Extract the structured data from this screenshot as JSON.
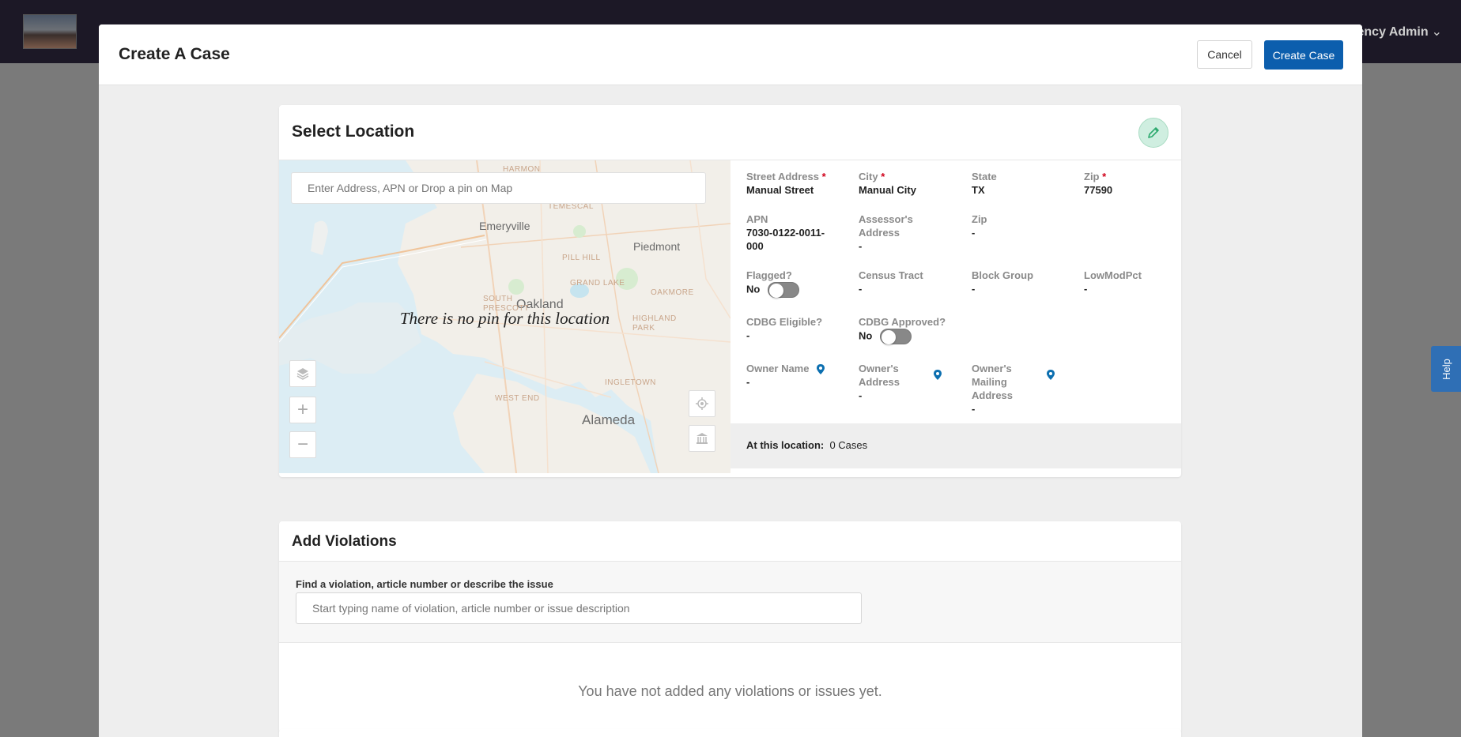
{
  "app": {
    "user_label": "ency Admin"
  },
  "help": {
    "label": "Help"
  },
  "modal": {
    "title": "Create A Case",
    "cancel_label": "Cancel",
    "create_label": "Create Case"
  },
  "location": {
    "title": "Select Location",
    "search_placeholder": "Enter Address, APN or Drop a pin on Map",
    "no_pin_message": "There is no pin for this location",
    "map_labels": {
      "emeryville": "Emeryville",
      "piedmont": "Piedmont",
      "oakland": "Oakland",
      "alameda": "Alameda",
      "harmon": "HARMON",
      "temescal": "TEMESCAL",
      "pill_hill": "PILL HILL",
      "grand_lake": "GRAND LAKE",
      "oakmore": "OAKMORE",
      "south_prescott": "SOUTH PRESCOTT",
      "highland_park": "HIGHLAND PARK",
      "west_end": "WEST END",
      "ingletown": "INGLETOWN"
    },
    "fields": {
      "street_label": "Street Address",
      "street_value": "Manual Street",
      "city_label": "City",
      "city_value": "Manual City",
      "state_label": "State",
      "state_value": "TX",
      "zip_label": "Zip",
      "zip_value": "77590",
      "apn_label": "APN",
      "apn_value_1": "7030-0122-0011-",
      "apn_value_2": "000",
      "assessor_label_1": "Assessor's",
      "assessor_label_2": "Address",
      "assessor_value": "-",
      "zip2_label": "Zip",
      "zip2_value": "-",
      "flagged_label": "Flagged?",
      "flagged_value": "No",
      "census_label": "Census Tract",
      "census_value": "-",
      "block_label": "Block Group",
      "block_value": "-",
      "lowmod_label": "LowModPct",
      "lowmod_value": "-",
      "cdbg_eligible_label": "CDBG Eligible?",
      "cdbg_eligible_value": "-",
      "cdbg_approved_label": "CDBG Approved?",
      "cdbg_approved_value": "No",
      "owner_name_label": "Owner Name",
      "owner_name_value": "-",
      "owner_address_label_1": "Owner's",
      "owner_address_label_2": "Address",
      "owner_address_value": "-",
      "owner_mailing_label_1": "Owner's",
      "owner_mailing_label_2": "Mailing",
      "owner_mailing_label_3": "Address",
      "owner_mailing_value": "-"
    },
    "at_location_label": "At this location:",
    "at_location_value": "0 Cases"
  },
  "violations": {
    "title": "Add Violations",
    "search_label": "Find a violation, article number or describe the issue",
    "search_placeholder": "Start typing name of violation, article number or issue description",
    "empty_message": "You have not added any violations or issues yet."
  },
  "colors": {
    "primary": "#0c5ead",
    "header_bg": "#1c1826",
    "required": "#d0021b",
    "edit_accent": "#2eaa6f"
  }
}
